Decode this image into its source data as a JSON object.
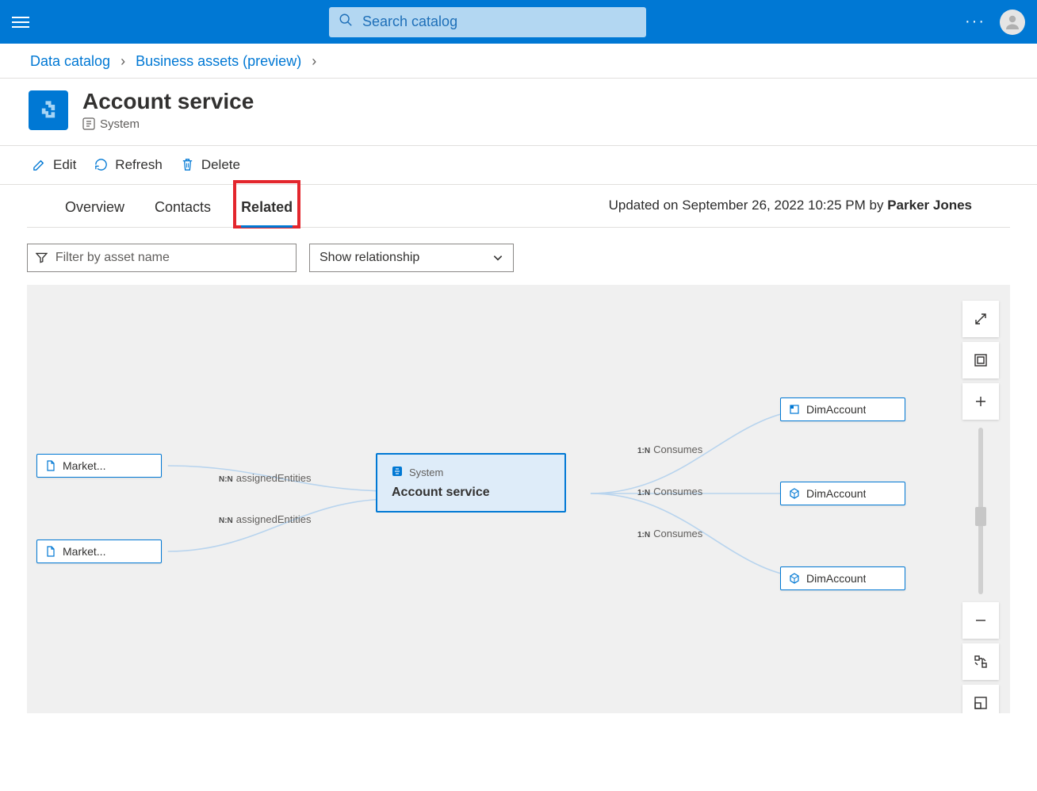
{
  "topbar": {
    "search_placeholder": "Search catalog"
  },
  "breadcrumb": {
    "item1": "Data catalog",
    "item2": "Business assets (preview)"
  },
  "asset": {
    "title": "Account service",
    "subtype": "System"
  },
  "commands": {
    "edit": "Edit",
    "refresh": "Refresh",
    "delete": "Delete"
  },
  "tabs": {
    "overview": "Overview",
    "contacts": "Contacts",
    "related": "Related"
  },
  "updated": {
    "prefix": "Updated on ",
    "date": "September 26, 2022 10:25 PM",
    "by": " by ",
    "author": "Parker Jones"
  },
  "controls": {
    "filter_placeholder": "Filter by asset name",
    "dropdown_label": "Show relationship"
  },
  "graph": {
    "left_nodes": [
      {
        "label": "Market..."
      },
      {
        "label": "Market..."
      }
    ],
    "left_edges": [
      {
        "card": "N:N",
        "label": "assignedEntities"
      },
      {
        "card": "N:N",
        "label": "assignedEntities"
      }
    ],
    "center": {
      "type": "System",
      "name": "Account service"
    },
    "right_edges": [
      {
        "card": "1:N",
        "label": "Consumes"
      },
      {
        "card": "1:N",
        "label": "Consumes"
      },
      {
        "card": "1:N",
        "label": "Consumes"
      }
    ],
    "right_nodes": [
      {
        "label": "DimAccount"
      },
      {
        "label": "DimAccount"
      },
      {
        "label": "DimAccount"
      }
    ]
  }
}
